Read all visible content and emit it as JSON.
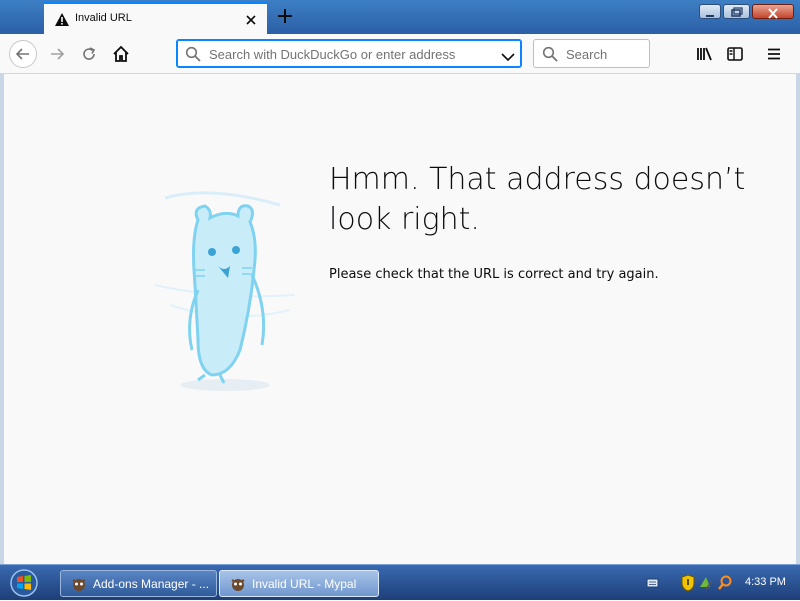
{
  "tab": {
    "title": "Invalid URL"
  },
  "toolbar": {
    "url_placeholder": "Search with DuckDuckGo or enter address",
    "search_placeholder": "Search"
  },
  "page": {
    "heading": "Hmm. That address doesn’t look right.",
    "description": "Please check that the URL is correct and try again."
  },
  "taskbar": {
    "items": [
      {
        "label": "Add-ons Manager - ..."
      },
      {
        "label": "Invalid URL - Mypal"
      }
    ],
    "clock": "4:33 PM"
  },
  "icons": {
    "tab_icon": "warning-icon",
    "nav": [
      "back-arrow-icon",
      "forward-arrow-icon",
      "reload-icon",
      "home-icon"
    ],
    "right": [
      "library-icon",
      "sidebar-icon",
      "hamburger-menu-icon"
    ]
  },
  "colors": {
    "accent": "#0a84ff",
    "titlebar": "#2b5fa6",
    "page_bg": "#f9f9fa",
    "text": "#0c0c0d",
    "illustration": "#7fd3f1"
  }
}
